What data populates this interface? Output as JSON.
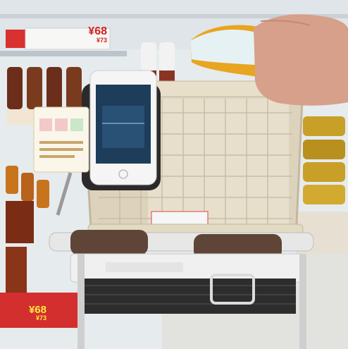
{
  "price_tags": [
    {
      "main": "¥68",
      "sub": "¥73"
    },
    {
      "main": "¥68",
      "sub": "¥73"
    }
  ],
  "colors": {
    "shelf": "#e9eef0",
    "basket": "#ddd3bd",
    "phone_screen": "#1e3d5a",
    "tea_bottle": "#e8a520",
    "cart_handle": "#5e4538",
    "price_red": "#d42020"
  }
}
